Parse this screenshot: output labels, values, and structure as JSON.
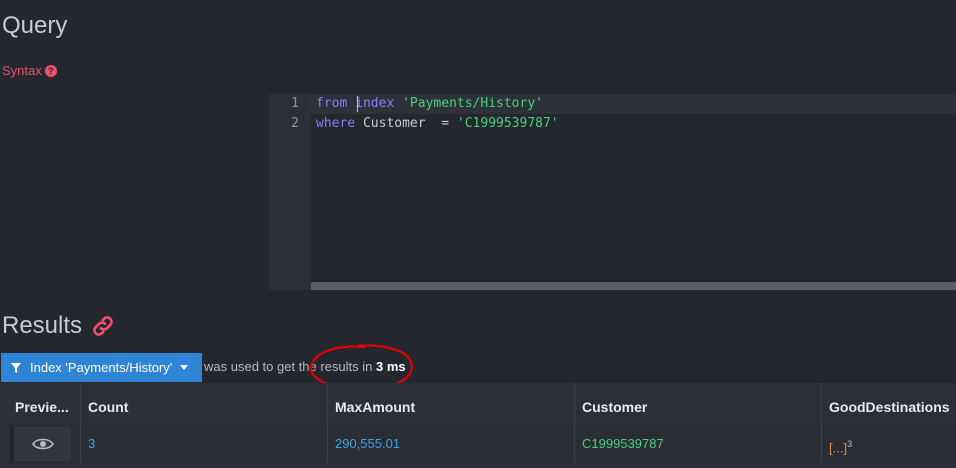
{
  "query_section": {
    "title": "Query",
    "syntax_label": "Syntax",
    "help_glyph": "?"
  },
  "editor": {
    "lines": [
      {
        "number": "1",
        "tokens": [
          {
            "t": "kw",
            "v": "from"
          },
          {
            "t": "plain",
            "v": " "
          },
          {
            "t": "kw",
            "v": "index"
          },
          {
            "t": "plain",
            "v": " "
          },
          {
            "t": "str",
            "v": "'Payments/History'"
          }
        ]
      },
      {
        "number": "2",
        "tokens": [
          {
            "t": "kw",
            "v": "where"
          },
          {
            "t": "plain",
            "v": " Customer  = "
          },
          {
            "t": "str",
            "v": "'C1999539787'"
          }
        ]
      }
    ]
  },
  "results_section": {
    "title": "Results",
    "index_button_label": "Index 'Payments/History'",
    "used_text_prefix": "was used to get the results in ",
    "duration": "3 ms"
  },
  "table": {
    "columns": [
      "Previe...",
      "Count",
      "MaxAmount",
      "Customer",
      "GoodDestinations"
    ],
    "rows": [
      {
        "count": "3",
        "max_amount": "290,555.01",
        "customer": "C1999539787",
        "good_destinations": "[...]",
        "good_destinations_count": "3"
      }
    ]
  },
  "colors": {
    "accent": "#2f84d6",
    "keyword": "#8c7bff",
    "string": "#46d17f",
    "danger": "#f0506e",
    "annotation": "#e00000"
  },
  "icons": [
    "help-icon",
    "link-icon",
    "filter-icon",
    "caret-down-icon",
    "eye-icon"
  ]
}
